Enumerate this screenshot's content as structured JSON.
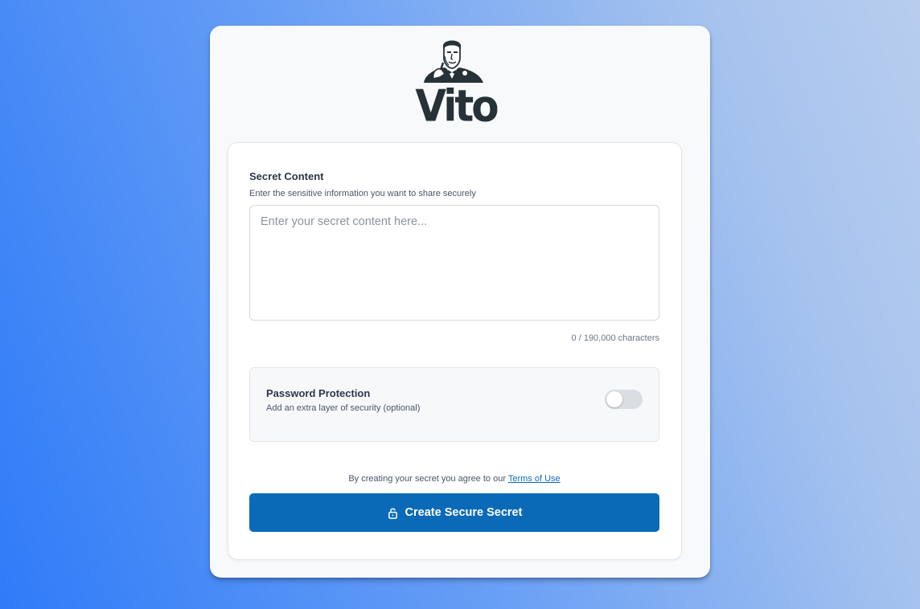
{
  "brand": {
    "name": "Vito",
    "logo_icon": "godfather-figure-logo"
  },
  "secret": {
    "label": "Secret Content",
    "help": "Enter the sensitive information you want to share securely",
    "placeholder": "Enter your secret content here...",
    "value": "",
    "char_count": "0 / 190,000 characters"
  },
  "password": {
    "title": "Password Protection",
    "subtitle": "Add an extra layer of security (optional)",
    "enabled": false
  },
  "terms": {
    "prefix": "By creating your secret you agree to our",
    "link_label": "Terms of Use"
  },
  "action": {
    "label": "Create Secure Secret",
    "icon": "lock-icon"
  },
  "colors": {
    "primary": "#0b6ab7",
    "link": "#0a6bbd",
    "text_dark": "#2d3748"
  }
}
